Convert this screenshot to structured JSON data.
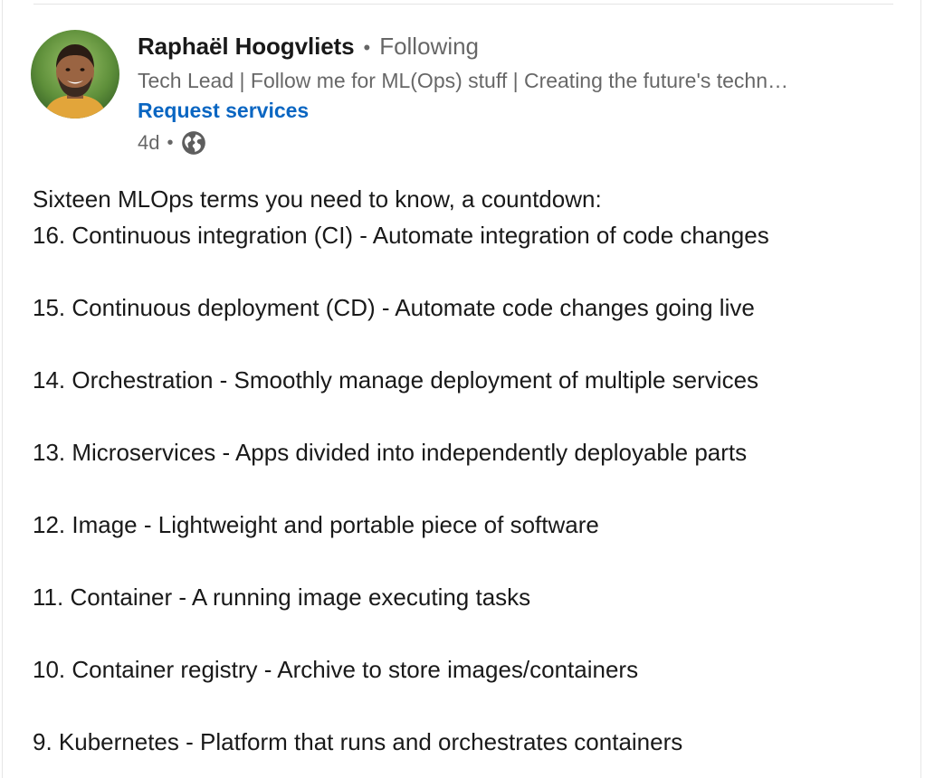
{
  "author": {
    "name": "Raphaël Hoogvliets",
    "separator": "•",
    "follow_status": "Following",
    "headline": "Tech Lead | Follow me for ML(Ops) stuff | Creating the future's techn…",
    "request_services": "Request services",
    "post_age": "4d",
    "age_separator": "•",
    "visibility_icon": "globe-icon"
  },
  "post": {
    "intro": "Sixteen MLOps terms you need to know, a countdown:",
    "items": [
      "16. Continuous integration (CI) - Automate integration of code changes",
      "15. Continuous deployment (CD) - Automate code changes going live",
      "14. Orchestration - Smoothly manage deployment of multiple services",
      "13. Microservices - Apps divided into independently deployable parts",
      "12. Image - Lightweight and portable piece of software",
      "11. Container - A running image executing tasks",
      "10. Container registry - Archive to store images/containers",
      "9. Kubernetes - Platform that runs and orchestrates containers"
    ]
  },
  "colors": {
    "link_blue": "#0a66c2",
    "secondary_text": "#666666",
    "primary_text": "#1a1a1a"
  }
}
